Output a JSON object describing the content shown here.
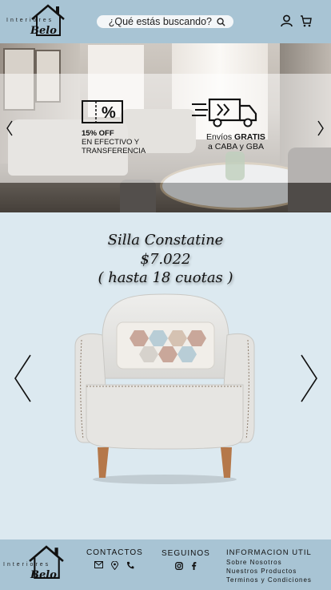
{
  "header": {
    "logo_tagline": "Interiores",
    "logo_brand": "Belo",
    "search_placeholder": "¿Qué estás buscando?"
  },
  "banner": {
    "promo_cash_percent": "15% OFF",
    "promo_cash_line1": "EN EFECTIVO Y",
    "promo_cash_line2": "TRANSFERENCIA",
    "promo_ship_prefix": "Envíos ",
    "promo_ship_bold": "GRATIS",
    "promo_ship_line2": "a CABA y GBA"
  },
  "product": {
    "name": "Silla Constatine",
    "price": "$7.022",
    "installments": "( hasta 18 cuotas )"
  },
  "footer": {
    "logo_tagline": "Interiores",
    "logo_brand": "Belo",
    "contact_title": "CONTACTOS",
    "follow_title": "SEGUINOS",
    "info_title": "INFORMACION UTIL",
    "links": [
      "Sobre Nosotros",
      "Nuestros Productos",
      "Terminos y Condiciones"
    ]
  }
}
